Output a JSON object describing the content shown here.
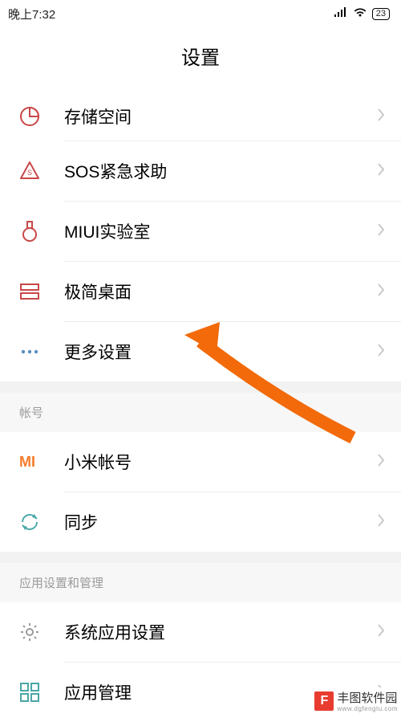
{
  "statusbar": {
    "time": "晚上7:32",
    "battery": "23"
  },
  "header": {
    "title": "设置"
  },
  "sections": {
    "main": [
      {
        "icon": "storage",
        "label": "存储空间"
      },
      {
        "icon": "sos",
        "label": "SOS紧急求助"
      },
      {
        "icon": "lab",
        "label": "MIUI实验室"
      },
      {
        "icon": "simple-desktop",
        "label": "极简桌面"
      },
      {
        "icon": "more",
        "label": "更多设置"
      }
    ],
    "account_header": "帐号",
    "account": [
      {
        "icon": "mi",
        "label": "小米帐号"
      },
      {
        "icon": "sync",
        "label": "同步"
      }
    ],
    "appmgmt_header": "应用设置和管理",
    "appmgmt": [
      {
        "icon": "gear",
        "label": "系统应用设置"
      },
      {
        "icon": "apps",
        "label": "应用管理"
      }
    ]
  },
  "colors": {
    "accent_orange": "#f26a0a",
    "icon_red": "#c94848",
    "icon_teal": "#4aa7a7",
    "icon_grey": "#bdbdbd",
    "mi_orange": "#f47b2a"
  },
  "watermark": {
    "badge": "F",
    "text": "丰图软件园",
    "sub": "www.dgfengtu.com"
  }
}
